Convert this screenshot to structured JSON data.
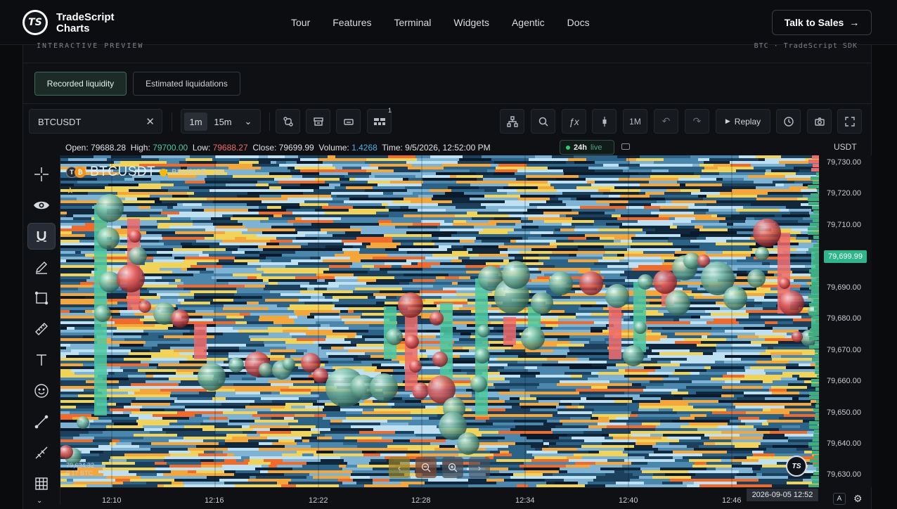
{
  "brand": {
    "name_line1": "TradeScript",
    "name_line2": "Charts",
    "logo_text": "TS"
  },
  "nav": {
    "links": [
      "Tour",
      "Features",
      "Terminal",
      "Widgets",
      "Agentic",
      "Docs"
    ],
    "cta": "Talk to Sales",
    "cta_arrow": "→"
  },
  "preview": {
    "left_label": "INTERACTIVE PREVIEW",
    "right_label": "BTC · TradeScript SDK"
  },
  "modes": {
    "recorded": "Recorded liquidity",
    "estimated": "Estimated liquidations"
  },
  "toolbar": {
    "symbol": "BTCUSDT",
    "clear": "✕",
    "timeframes": [
      "1m",
      "15m"
    ],
    "tf_dropdown": "⌄",
    "layout_badge": "1",
    "month": "1M",
    "replay": "Replay",
    "replay_icon": "▶"
  },
  "ohlc": {
    "open_label": "Open:",
    "open": "79688.28",
    "high_label": "High:",
    "high": "79700.00",
    "low_label": "Low:",
    "low": "79688.27",
    "close_label": "Close:",
    "close": "79699.99",
    "volume_label": "Volume:",
    "volume": "1.4268",
    "time_label": "Time:",
    "time": "9/5/2026, 12:52:00 PM",
    "range": "24h",
    "live": "live"
  },
  "axis": {
    "currency": "USDT",
    "y_ticks": [
      "79,730.00",
      "79,720.00",
      "79,710.00",
      "79,699.99",
      "79,690.00",
      "79,680.00",
      "79,670.00",
      "79,660.00",
      "79,650.00",
      "79,640.00",
      "79,630.00"
    ],
    "current_price": "79,699.99",
    "x_ticks": [
      "12:10",
      "12:16",
      "12:22",
      "12:28",
      "12:34",
      "12:40",
      "12:46"
    ],
    "crosshair_time": "2026-09-05 12:52",
    "auto": "A"
  },
  "legend": {
    "symbol": "BTCUSDT",
    "exchange": "BINANCE · 1m",
    "bottom_price": "79,634.32",
    "bottom_size": "0.17 BTC"
  },
  "colors": {
    "bull": "#4ec9a0",
    "bear": "#ef6b6b",
    "accent_price": "#2fb58a"
  }
}
